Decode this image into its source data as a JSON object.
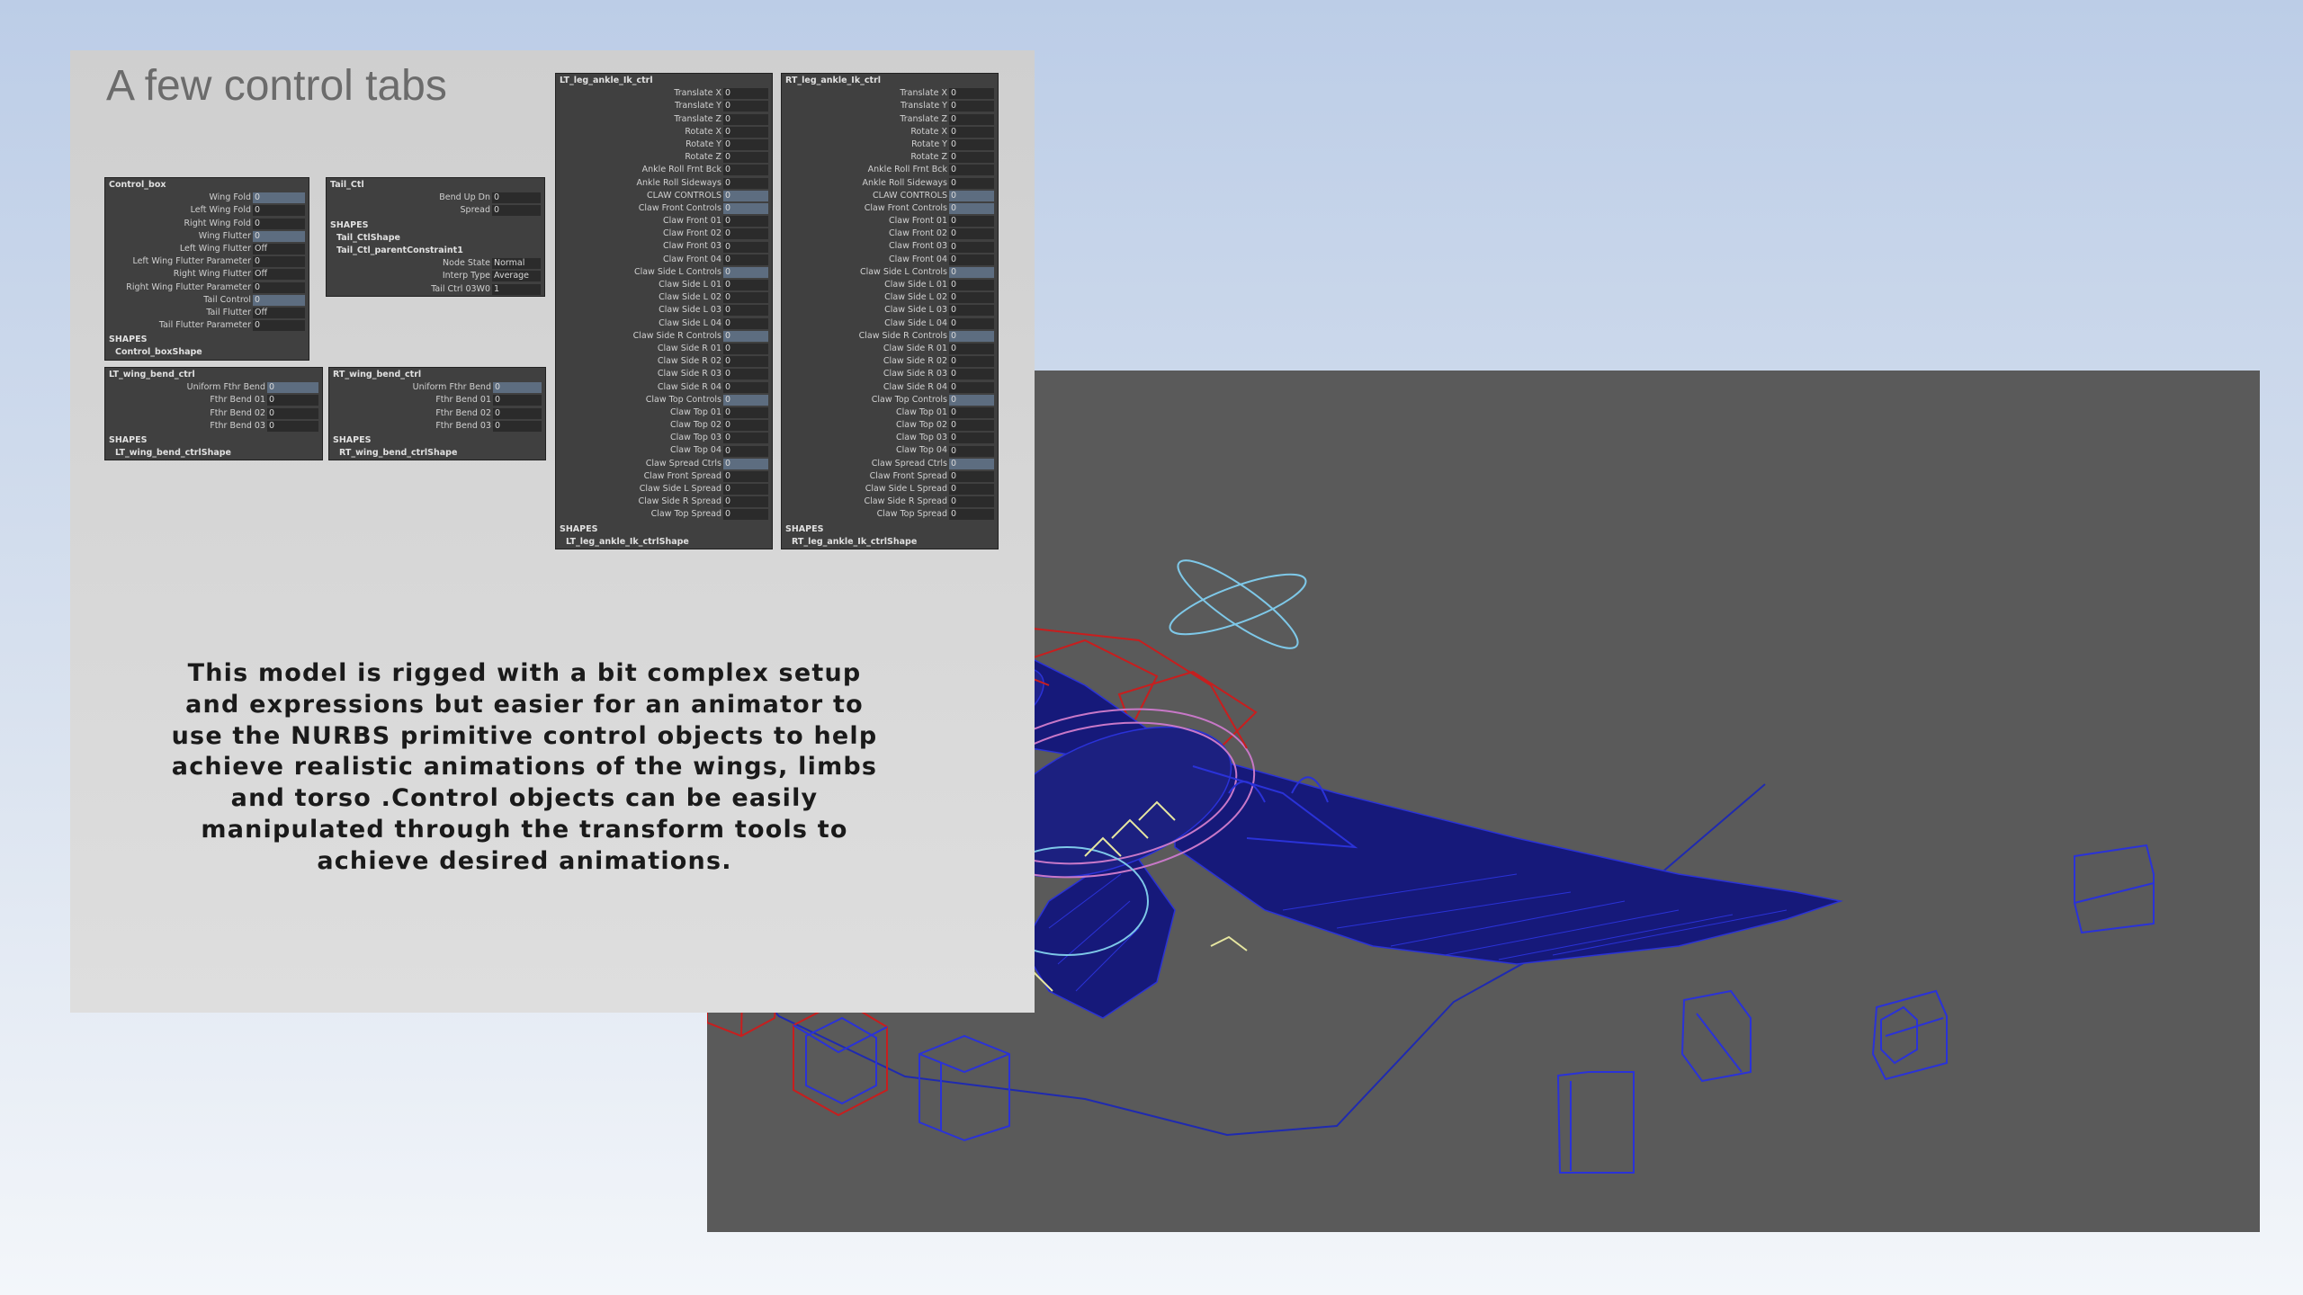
{
  "slide": {
    "title": "A few control tabs",
    "description": "This model is rigged with a bit complex setup and expressions but easier for an animator to use the NURBS primitive control objects to help achieve realistic animations of the wings, limbs and torso .Control objects can be easily manipulated through the transform tools to achieve desired animations."
  },
  "panels": [
    {
      "name": "Control_box",
      "shapes_label": "SHAPES",
      "shapes": [
        "Control_boxShape"
      ],
      "attrs": [
        {
          "label": "Wing Fold",
          "value": "0",
          "hl": true
        },
        {
          "label": "Left Wing Fold",
          "value": "0"
        },
        {
          "label": "Right Wing Fold",
          "value": "0"
        },
        {
          "label": "Wing Flutter",
          "value": "0",
          "hl": true
        },
        {
          "label": "Left Wing Flutter",
          "value": "Off"
        },
        {
          "label": "Left Wing Flutter Parameter",
          "value": "0"
        },
        {
          "label": "Right Wing Flutter",
          "value": "Off"
        },
        {
          "label": "Right Wing Flutter Parameter",
          "value": "0"
        },
        {
          "label": "Tail Control",
          "value": "0",
          "hl": true
        },
        {
          "label": "Tail Flutter",
          "value": "Off"
        },
        {
          "label": "Tail Flutter Parameter",
          "value": "0"
        }
      ]
    },
    {
      "name": "Tail_Ctl",
      "shapes_label": "SHAPES",
      "shapes": [
        "Tail_CtlShape",
        "Tail_Ctl_parentConstraint1"
      ],
      "attrs": [
        {
          "label": "Bend Up Dn",
          "value": "0"
        },
        {
          "label": "Spread",
          "value": "0"
        }
      ],
      "extra": [
        {
          "label": "Node State",
          "value": "Normal"
        },
        {
          "label": "Interp Type",
          "value": "Average"
        },
        {
          "label": "Tail Ctrl 03W0",
          "value": "1"
        }
      ]
    },
    {
      "name": "LT_wing_bend_ctrl",
      "shapes_label": "SHAPES",
      "shapes": [
        "LT_wing_bend_ctrlShape"
      ],
      "attrs": [
        {
          "label": "Uniform Fthr Bend",
          "value": "0",
          "hl": true
        },
        {
          "label": "Fthr Bend 01",
          "value": "0"
        },
        {
          "label": "Fthr Bend 02",
          "value": "0"
        },
        {
          "label": "Fthr Bend 03",
          "value": "0"
        }
      ]
    },
    {
      "name": "RT_wing_bend_ctrl",
      "shapes_label": "SHAPES",
      "shapes": [
        "RT_wing_bend_ctrlShape"
      ],
      "attrs": [
        {
          "label": "Uniform Fthr Bend",
          "value": "0",
          "hl": true
        },
        {
          "label": "Fthr Bend 01",
          "value": "0"
        },
        {
          "label": "Fthr Bend 02",
          "value": "0"
        },
        {
          "label": "Fthr Bend 03",
          "value": "0"
        }
      ]
    },
    {
      "name": "LT_leg_ankle_Ik_ctrl",
      "shapes_label": "SHAPES",
      "shapes": [
        "LT_leg_ankle_Ik_ctrlShape"
      ],
      "attrs": [
        {
          "label": "Translate X",
          "value": "0"
        },
        {
          "label": "Translate Y",
          "value": "0"
        },
        {
          "label": "Translate Z",
          "value": "0"
        },
        {
          "label": "Rotate X",
          "value": "0"
        },
        {
          "label": "Rotate Y",
          "value": "0"
        },
        {
          "label": "Rotate Z",
          "value": "0"
        },
        {
          "label": "Ankle Roll Frnt Bck",
          "value": "0"
        },
        {
          "label": "Ankle Roll Sideways",
          "value": "0"
        },
        {
          "label": "CLAW CONTROLS",
          "value": "0",
          "hl": true
        },
        {
          "label": "Claw Front Controls",
          "value": "0",
          "hl": true
        },
        {
          "label": "Claw Front 01",
          "value": "0"
        },
        {
          "label": "Claw Front 02",
          "value": "0"
        },
        {
          "label": "Claw Front 03",
          "value": "0"
        },
        {
          "label": "Claw Front 04",
          "value": "0"
        },
        {
          "label": "Claw Side L Controls",
          "value": "0",
          "hl": true
        },
        {
          "label": "Claw Side L 01",
          "value": "0"
        },
        {
          "label": "Claw Side L 02",
          "value": "0"
        },
        {
          "label": "Claw Side L 03",
          "value": "0"
        },
        {
          "label": "Claw Side L 04",
          "value": "0"
        },
        {
          "label": "Claw Side R Controls",
          "value": "0",
          "hl": true
        },
        {
          "label": "Claw Side R 01",
          "value": "0"
        },
        {
          "label": "Claw Side R 02",
          "value": "0"
        },
        {
          "label": "Claw Side R 03",
          "value": "0"
        },
        {
          "label": "Claw Side R 04",
          "value": "0"
        },
        {
          "label": "Claw Top Controls",
          "value": "0",
          "hl": true
        },
        {
          "label": "Claw Top 01",
          "value": "0"
        },
        {
          "label": "Claw Top 02",
          "value": "0"
        },
        {
          "label": "Claw Top 03",
          "value": "0"
        },
        {
          "label": "Claw Top 04",
          "value": "0"
        },
        {
          "label": "Claw Spread Ctrls",
          "value": "0",
          "hl": true
        },
        {
          "label": "Claw Front Spread",
          "value": "0"
        },
        {
          "label": "Claw Side L Spread",
          "value": "0"
        },
        {
          "label": "Claw Side R Spread",
          "value": "0"
        },
        {
          "label": "Claw Top Spread",
          "value": "0"
        }
      ]
    },
    {
      "name": "RT_leg_ankle_Ik_ctrl",
      "shapes_label": "SHAPES",
      "shapes": [
        "RT_leg_ankle_Ik_ctrlShape"
      ],
      "attrs": [
        {
          "label": "Translate X",
          "value": "0"
        },
        {
          "label": "Translate Y",
          "value": "0"
        },
        {
          "label": "Translate Z",
          "value": "0"
        },
        {
          "label": "Rotate X",
          "value": "0"
        },
        {
          "label": "Rotate Y",
          "value": "0"
        },
        {
          "label": "Rotate Z",
          "value": "0"
        },
        {
          "label": "Ankle Roll Frnt Bck",
          "value": "0"
        },
        {
          "label": "Ankle Roll Sideways",
          "value": "0"
        },
        {
          "label": "CLAW CONTROLS",
          "value": "0",
          "hl": true
        },
        {
          "label": "Claw Front Controls",
          "value": "0",
          "hl": true
        },
        {
          "label": "Claw Front 01",
          "value": "0"
        },
        {
          "label": "Claw Front 02",
          "value": "0"
        },
        {
          "label": "Claw Front 03",
          "value": "0"
        },
        {
          "label": "Claw Front 04",
          "value": "0"
        },
        {
          "label": "Claw Side L Controls",
          "value": "0",
          "hl": true
        },
        {
          "label": "Claw Side L 01",
          "value": "0"
        },
        {
          "label": "Claw Side L 02",
          "value": "0"
        },
        {
          "label": "Claw Side L 03",
          "value": "0"
        },
        {
          "label": "Claw Side L 04",
          "value": "0"
        },
        {
          "label": "Claw Side R Controls",
          "value": "0",
          "hl": true
        },
        {
          "label": "Claw Side R 01",
          "value": "0"
        },
        {
          "label": "Claw Side R 02",
          "value": "0"
        },
        {
          "label": "Claw Side R 03",
          "value": "0"
        },
        {
          "label": "Claw Side R 04",
          "value": "0"
        },
        {
          "label": "Claw Top Controls",
          "value": "0",
          "hl": true
        },
        {
          "label": "Claw Top 01",
          "value": "0"
        },
        {
          "label": "Claw Top 02",
          "value": "0"
        },
        {
          "label": "Claw Top 03",
          "value": "0"
        },
        {
          "label": "Claw Top 04",
          "value": "0"
        },
        {
          "label": "Claw Spread Ctrls",
          "value": "0",
          "hl": true
        },
        {
          "label": "Claw Front Spread",
          "value": "0"
        },
        {
          "label": "Claw Side L Spread",
          "value": "0"
        },
        {
          "label": "Claw Side R Spread",
          "value": "0"
        },
        {
          "label": "Claw Top Spread",
          "value": "0"
        }
      ]
    }
  ],
  "viewport": {
    "background_color": "#5a5a5a",
    "mesh_color": "#141a7a",
    "wire_color": "#1428b4",
    "control_red": "#c81e1e",
    "control_blue": "#2a32d8",
    "control_cyan": "#7ec8e8",
    "control_pink": "#c878c8",
    "control_yellow": "#e6e6a0"
  }
}
